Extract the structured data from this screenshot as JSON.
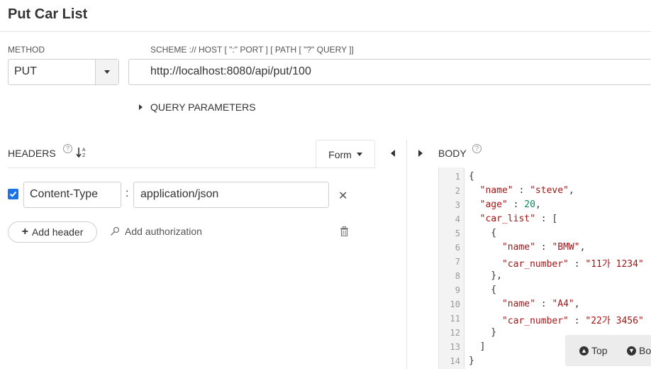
{
  "page": {
    "title": "Put Car List"
  },
  "request": {
    "method_label": "METHOD",
    "method_value": "PUT",
    "scheme_label": "SCHEME :// HOST [ \":\" PORT ] [ PATH [ \"?\" QUERY ]]",
    "url_value": "http://localhost:8080/api/put/100",
    "query_params_label": "QUERY PARAMETERS"
  },
  "headers": {
    "label": "HEADERS",
    "form_label": "Form",
    "rows": [
      {
        "checked": true,
        "key": "Content-Type",
        "value": "application/json"
      }
    ],
    "add_header_label": "Add header",
    "add_auth_label": "Add authorization"
  },
  "body": {
    "label": "BODY",
    "line_numbers": [
      "1",
      "2",
      "3",
      "4",
      "5",
      "6",
      "7",
      "8",
      "9",
      "10",
      "11",
      "12",
      "13",
      "14"
    ],
    "lines": [
      "{",
      "  \"name\" : \"steve\",",
      "  \"age\" : 20,",
      "  \"car_list\" : [",
      "    {",
      "      \"name\" : \"BMW\",",
      "      \"car_number\" : \"11가 1234\"",
      "    },",
      "    {",
      "      \"name\" : \"A4\",",
      "      \"car_number\" : \"22가 3456\"",
      "    }",
      "  ]",
      "}"
    ]
  },
  "float_nav": {
    "top_label": "Top",
    "bottom_label": "Bo"
  },
  "icons": {
    "help": "question-circle-icon",
    "sort": "sort-az-icon",
    "check": "checkbox-checked-icon",
    "remove": "close-icon",
    "auth": "key-icon",
    "trash": "trash-icon"
  },
  "colors": {
    "accent": "#1a73e8",
    "string": "#a31515",
    "number": "#098658"
  }
}
